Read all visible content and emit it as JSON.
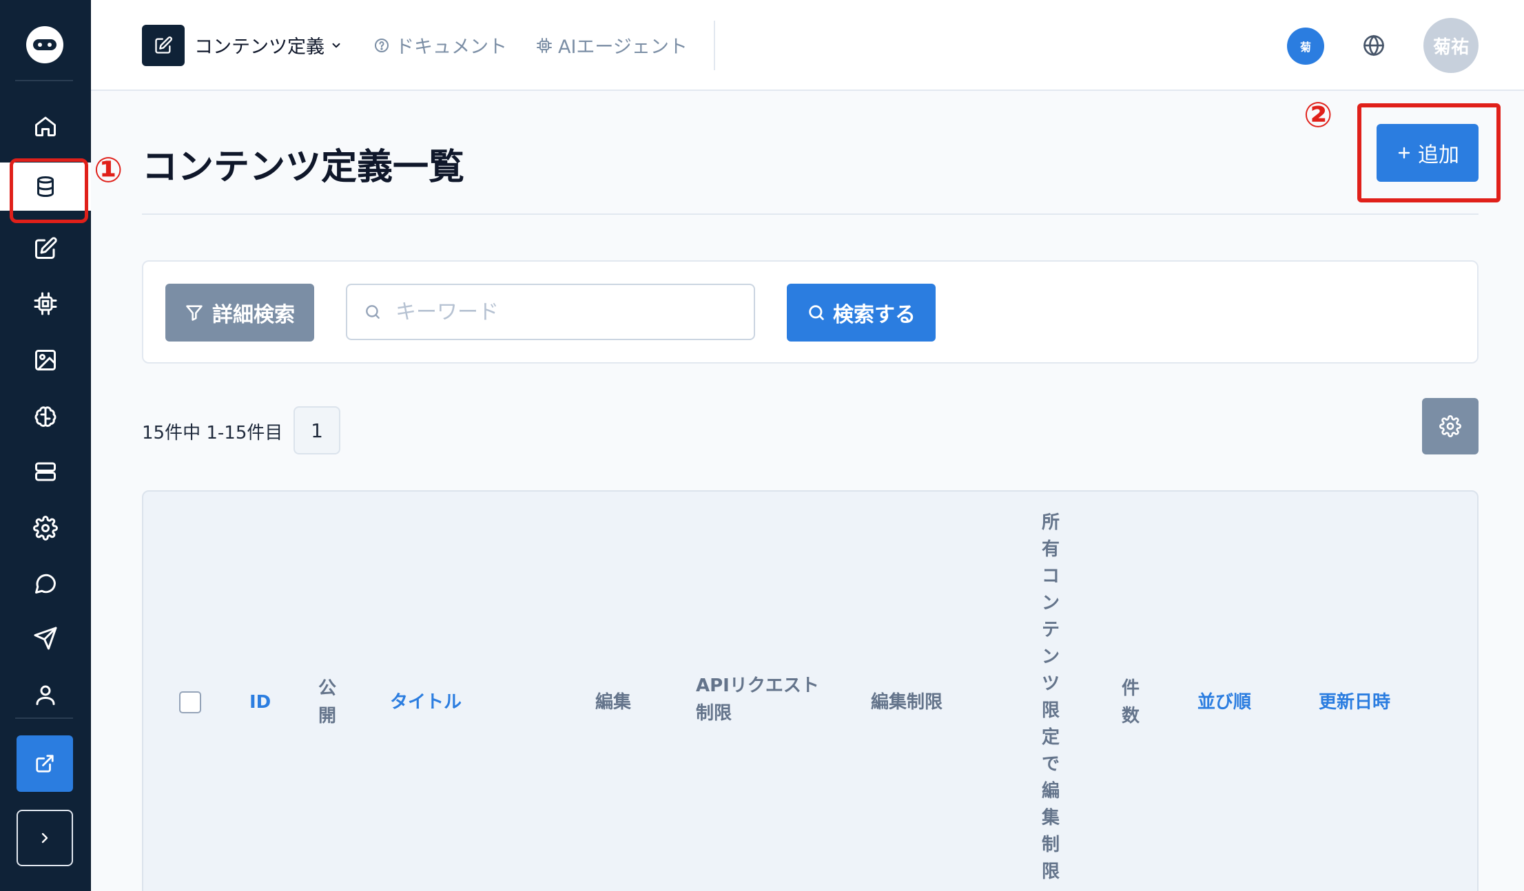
{
  "header": {
    "section_label": "コンテンツ定義",
    "docs_label": "ドキュメント",
    "ai_label": "AIエージェント",
    "workspace_badge": "菊",
    "user_name": "菊祐"
  },
  "annotations": {
    "one": "①",
    "two": "②"
  },
  "sidebar": {
    "items": [
      {
        "icon": "home-icon"
      },
      {
        "icon": "database-icon",
        "active": true
      },
      {
        "icon": "edit-icon"
      },
      {
        "icon": "chip-icon"
      },
      {
        "icon": "image-icon"
      },
      {
        "icon": "brain-icon"
      },
      {
        "icon": "server-icon"
      },
      {
        "icon": "gear-icon"
      },
      {
        "icon": "chat-icon"
      },
      {
        "icon": "send-icon"
      },
      {
        "icon": "user-icon"
      }
    ]
  },
  "page": {
    "title": "コンテンツ定義一覧",
    "add_label": "追加"
  },
  "search": {
    "filter_label": "詳細検索",
    "placeholder": "キーワード",
    "value": "",
    "submit_label": "検索する"
  },
  "pagination": {
    "summary": "15件中 1-15件目",
    "current_page": "1"
  },
  "table": {
    "columns": {
      "id": "ID",
      "published": "公開",
      "title": "タイトル",
      "edit": "編集",
      "api_limit_line1": "APIリクエスト",
      "api_limit_line2": "制限",
      "edit_limit": "編集制限",
      "owner_limit": "所有コンテンツ限定で編集制限",
      "count": "件数",
      "order": "並び順",
      "updated": "更新日時"
    }
  },
  "colors": {
    "sidebar": "#0f2237",
    "accent": "#2b7de0",
    "annotation": "#e0201a",
    "muted_button": "#7b8ea5"
  }
}
